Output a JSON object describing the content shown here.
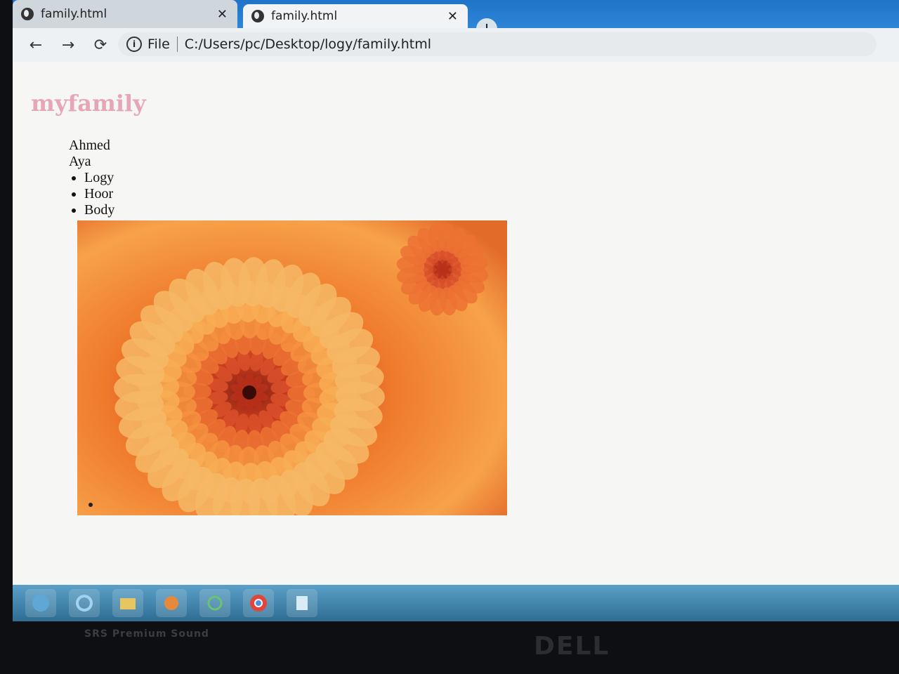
{
  "browser": {
    "tabs": [
      {
        "title": "family.html",
        "active": false
      },
      {
        "title": "family.html",
        "active": true
      }
    ],
    "new_tab_label": "+",
    "toolbar": {
      "back_icon": "←",
      "forward_icon": "→",
      "reload_icon": "⟳",
      "info_icon": "i",
      "scheme_label": "File",
      "url": "C:/Users/pc/Desktop/logy/family.html"
    }
  },
  "page": {
    "heading": "myfamily",
    "plain_names": [
      "Ahmed",
      "Aya"
    ],
    "bulleted_names": [
      "Logy",
      "Hoor",
      "Body"
    ],
    "image_subject": "orange chrysanthemum flower close-up"
  },
  "colors": {
    "heading": "#e7a6b8",
    "taskbar": "#3b7ea6",
    "tabstrip": "#1f73c8"
  },
  "taskbar": {
    "icons": [
      "start-orb-icon",
      "internet-explorer-icon",
      "folder-icon",
      "media-player-icon",
      "sync-icon",
      "chrome-icon",
      "notepad-icon"
    ]
  },
  "bezel": {
    "brand": "DELL",
    "sound_label": "SRS Premium Sound"
  }
}
